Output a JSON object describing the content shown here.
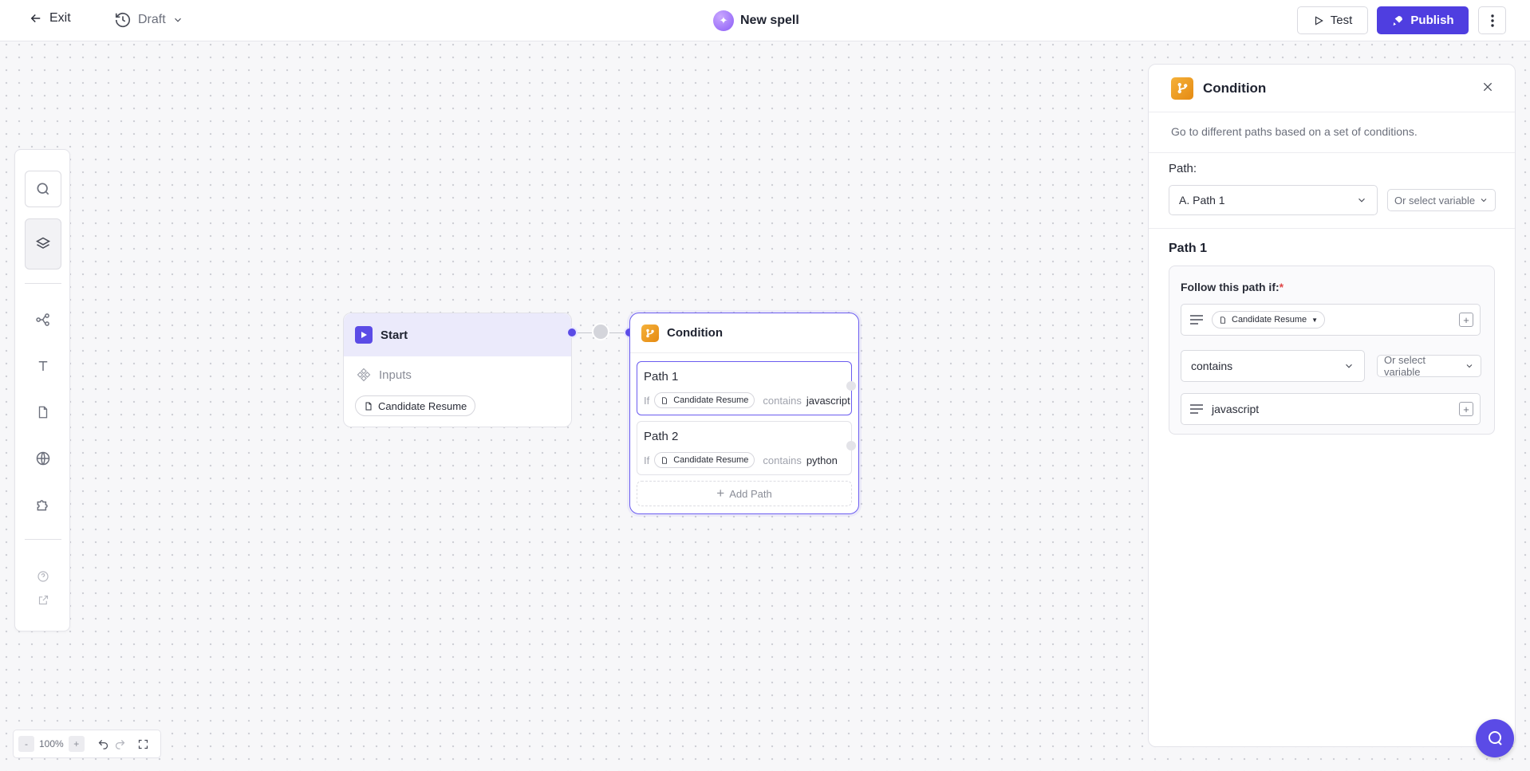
{
  "topbar": {
    "exit_label": "Exit",
    "draft_label": "Draft",
    "title": "New spell",
    "test_label": "Test",
    "publish_label": "Publish"
  },
  "colors": {
    "accent": "#4f3ee0",
    "condition": "#e58a12"
  },
  "zoom": {
    "level": "100%",
    "minus": "-",
    "plus": "+"
  },
  "nodes": {
    "start": {
      "title": "Start",
      "inputs_label": "Inputs",
      "input_chip": "Candidate Resume"
    },
    "condition": {
      "title": "Condition",
      "paths": [
        {
          "title": "Path 1",
          "if": "If",
          "variable": "Candidate Resume",
          "operator": "contains",
          "value": "javascript"
        },
        {
          "title": "Path 2",
          "if": "If",
          "variable": "Candidate Resume",
          "operator": "contains",
          "value": "python"
        }
      ],
      "add_path": "Add Path"
    }
  },
  "panel": {
    "title": "Condition",
    "description": "Go to different paths based on a set of conditions.",
    "path_label": "Path:",
    "path_select": "A. Path 1",
    "or_select_variable": "Or select variable",
    "path_section_title": "Path 1",
    "follow_label": "Follow this path if:",
    "required_mark": "*",
    "condition_variable": "Candidate Resume",
    "operator": "contains",
    "value": "javascript"
  }
}
